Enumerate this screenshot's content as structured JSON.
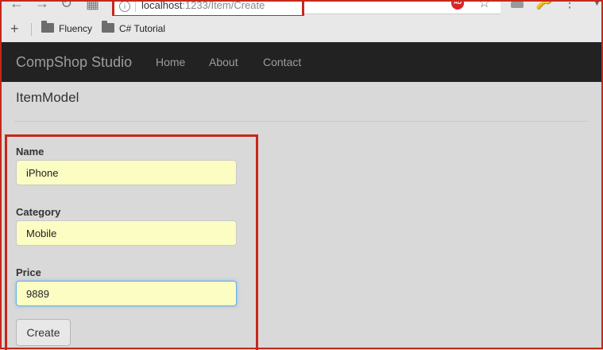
{
  "browser": {
    "url_host": "localhost",
    "url_rest": ":1233/Item/Create",
    "extension_badge": "AD"
  },
  "bookmarks": [
    {
      "label": "Fluency"
    },
    {
      "label": "C# Tutorial"
    }
  ],
  "navbar": {
    "brand": "CompShop Studio",
    "links": [
      "Home",
      "About",
      "Contact"
    ]
  },
  "page": {
    "heading": "ItemModel"
  },
  "form": {
    "fields": [
      {
        "label": "Name",
        "value": "iPhone"
      },
      {
        "label": "Category",
        "value": "Mobile"
      },
      {
        "label": "Price",
        "value": "9889"
      }
    ],
    "submit_label": "Create"
  },
  "colors": {
    "highlight_frame": "#c6271d",
    "navbar_bg": "#222222",
    "input_bg": "#fcfdc3",
    "focus_border": "#66afe9"
  }
}
